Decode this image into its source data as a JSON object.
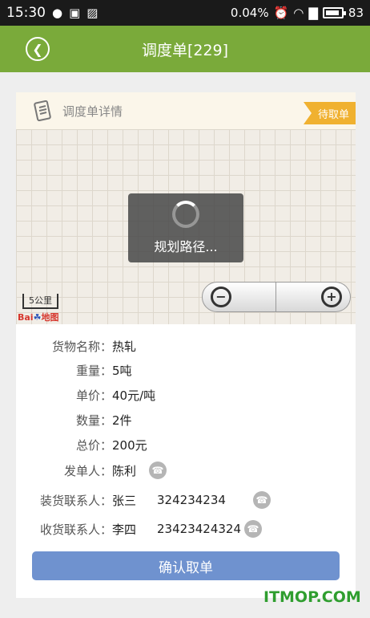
{
  "status_bar": {
    "time": "15:30",
    "data_rate": "0.04%",
    "battery": "83"
  },
  "nav": {
    "title": "调度单[229]"
  },
  "card": {
    "title": "调度单详情",
    "status": "待取单"
  },
  "map": {
    "loading_text": "规划路径...",
    "scale_label": "5公里",
    "logo_text": "Bai",
    "logo_suffix": "地图"
  },
  "details": {
    "goods_label": "货物名称：",
    "goods": "热轧",
    "weight_label": "重量：",
    "weight": "5吨",
    "unit_price_label": "单价：",
    "unit_price": "40元/吨",
    "quantity_label": "数量：",
    "quantity": "2件",
    "total_label": "总价：",
    "total": "200元",
    "sender_label": "发单人：",
    "sender": "陈利",
    "loading_contact_label": "装货联系人：",
    "loading_contact": "张三",
    "loading_phone": "324234234",
    "receiving_contact_label": "收货联系人：",
    "receiving_contact": "李四",
    "receiving_phone": "23423424324"
  },
  "confirm_button": "确认取单",
  "watermark": "ITMOP.COM",
  "colors": {
    "nav_green": "#7aaa3a",
    "status_orange": "#f0b130",
    "button_blue": "#6f92cf"
  }
}
